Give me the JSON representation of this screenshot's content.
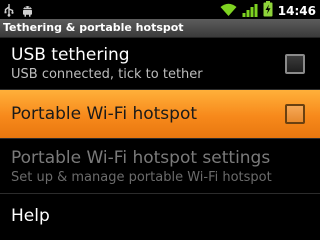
{
  "status_bar": {
    "time": "14:46",
    "icons": [
      "usb-icon",
      "android-debug-icon",
      "wifi-icon",
      "signal-icon",
      "battery-charging-icon"
    ]
  },
  "title": "Tethering & portable hotspot",
  "items": [
    {
      "title": "USB tethering",
      "summary": "USB connected, tick to tether",
      "checked": false,
      "enabled": true
    },
    {
      "title": "Portable Wi-Fi hotspot",
      "checked": false,
      "enabled": true,
      "highlighted": true
    },
    {
      "title": "Portable Wi-Fi hotspot settings",
      "summary": "Set up & manage portable Wi-Fi hotspot",
      "enabled": false
    },
    {
      "title": "Help",
      "enabled": true
    }
  ],
  "colors": {
    "highlight": "#f7891b",
    "background": "#000000",
    "wifi_icon": "#7ed321",
    "battery": "#8fd43a"
  }
}
